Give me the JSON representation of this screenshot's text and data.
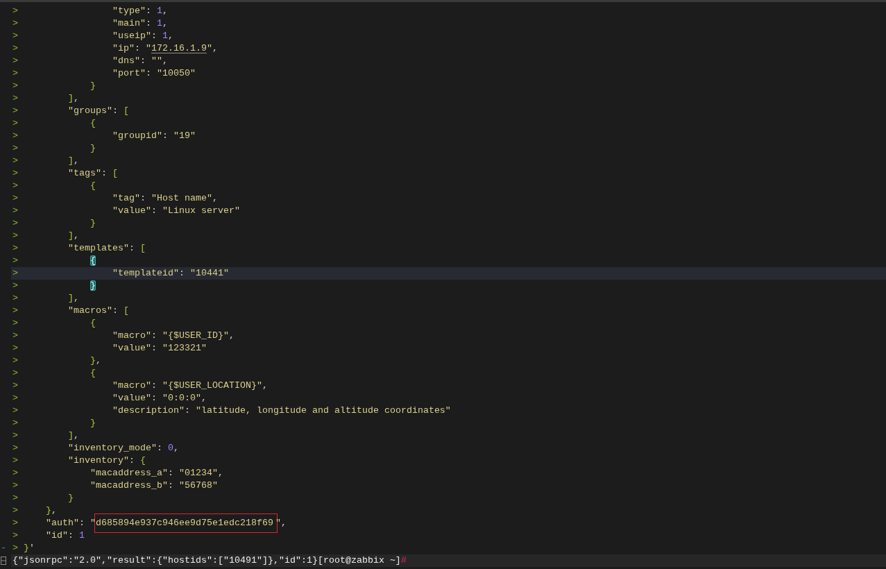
{
  "terminal": {
    "lines": [
      {
        "prompt": ">",
        "current": false,
        "segments": [
          {
            "kind": "string",
            "text": "                 \"type\""
          },
          {
            "kind": "punct",
            "text": ": "
          },
          {
            "kind": "number",
            "text": "1"
          },
          {
            "kind": "punct",
            "text": ","
          }
        ]
      },
      {
        "prompt": ">",
        "current": false,
        "segments": [
          {
            "kind": "string",
            "text": "                 \"main\""
          },
          {
            "kind": "punct",
            "text": ": "
          },
          {
            "kind": "number",
            "text": "1"
          },
          {
            "kind": "punct",
            "text": ","
          }
        ]
      },
      {
        "prompt": ">",
        "current": false,
        "segments": [
          {
            "kind": "string",
            "text": "                 \"useip\""
          },
          {
            "kind": "punct",
            "text": ": "
          },
          {
            "kind": "number",
            "text": "1"
          },
          {
            "kind": "punct",
            "text": ","
          }
        ]
      },
      {
        "prompt": ">",
        "current": false,
        "segments": [
          {
            "kind": "string",
            "text": "                 \"ip\""
          },
          {
            "kind": "punct",
            "text": ": "
          },
          {
            "kind": "string",
            "text": "\""
          },
          {
            "kind": "link",
            "text": "172.16.1.9"
          },
          {
            "kind": "string",
            "text": "\""
          },
          {
            "kind": "punct",
            "text": ","
          }
        ]
      },
      {
        "prompt": ">",
        "current": false,
        "segments": [
          {
            "kind": "string",
            "text": "                 \"dns\""
          },
          {
            "kind": "punct",
            "text": ": "
          },
          {
            "kind": "string",
            "text": "\"\""
          },
          {
            "kind": "punct",
            "text": ","
          }
        ]
      },
      {
        "prompt": ">",
        "current": false,
        "segments": [
          {
            "kind": "string",
            "text": "                 \"port\""
          },
          {
            "kind": "punct",
            "text": ": "
          },
          {
            "kind": "string",
            "text": "\"10050\""
          }
        ]
      },
      {
        "prompt": ">",
        "current": false,
        "segments": [
          {
            "kind": "bracket",
            "text": "             }"
          }
        ]
      },
      {
        "prompt": ">",
        "current": false,
        "segments": [
          {
            "kind": "bracket",
            "text": "         ]"
          },
          {
            "kind": "punct",
            "text": ","
          }
        ]
      },
      {
        "prompt": ">",
        "current": false,
        "segments": [
          {
            "kind": "string",
            "text": "         \"groups\""
          },
          {
            "kind": "punct",
            "text": ": "
          },
          {
            "kind": "bracket",
            "text": "["
          }
        ]
      },
      {
        "prompt": ">",
        "current": false,
        "segments": [
          {
            "kind": "bracket",
            "text": "             {"
          }
        ]
      },
      {
        "prompt": ">",
        "current": false,
        "segments": [
          {
            "kind": "string",
            "text": "                 \"groupid\""
          },
          {
            "kind": "punct",
            "text": ": "
          },
          {
            "kind": "string",
            "text": "\"19\""
          }
        ]
      },
      {
        "prompt": ">",
        "current": false,
        "segments": [
          {
            "kind": "bracket",
            "text": "             }"
          }
        ]
      },
      {
        "prompt": ">",
        "current": false,
        "segments": [
          {
            "kind": "bracket",
            "text": "         ]"
          },
          {
            "kind": "punct",
            "text": ","
          }
        ]
      },
      {
        "prompt": ">",
        "current": false,
        "segments": [
          {
            "kind": "string",
            "text": "         \"tags\""
          },
          {
            "kind": "punct",
            "text": ": "
          },
          {
            "kind": "bracket",
            "text": "["
          }
        ]
      },
      {
        "prompt": ">",
        "current": false,
        "segments": [
          {
            "kind": "bracket",
            "text": "             {"
          }
        ]
      },
      {
        "prompt": ">",
        "current": false,
        "segments": [
          {
            "kind": "string",
            "text": "                 \"tag\""
          },
          {
            "kind": "punct",
            "text": ": "
          },
          {
            "kind": "string",
            "text": "\"Host name\""
          },
          {
            "kind": "punct",
            "text": ","
          }
        ]
      },
      {
        "prompt": ">",
        "current": false,
        "segments": [
          {
            "kind": "string",
            "text": "                 \"value\""
          },
          {
            "kind": "punct",
            "text": ": "
          },
          {
            "kind": "string",
            "text": "\"Linux server\""
          }
        ]
      },
      {
        "prompt": ">",
        "current": false,
        "segments": [
          {
            "kind": "bracket",
            "text": "             }"
          }
        ]
      },
      {
        "prompt": ">",
        "current": false,
        "segments": [
          {
            "kind": "bracket",
            "text": "         ]"
          },
          {
            "kind": "punct",
            "text": ","
          }
        ]
      },
      {
        "prompt": ">",
        "current": false,
        "segments": [
          {
            "kind": "string",
            "text": "         \"templates\""
          },
          {
            "kind": "punct",
            "text": ": "
          },
          {
            "kind": "bracket",
            "text": "["
          }
        ]
      },
      {
        "prompt": ">",
        "current": false,
        "segments": [
          {
            "kind": "matched_bracket",
            "text": "             {"
          }
        ]
      },
      {
        "prompt": ">",
        "current": true,
        "segments": [
          {
            "kind": "string",
            "text": "                 \"templateid\""
          },
          {
            "kind": "punct",
            "text": ": "
          },
          {
            "kind": "string",
            "text": "\"10441\""
          }
        ]
      },
      {
        "prompt": ">",
        "current": false,
        "segments": [
          {
            "kind": "matched_bracket",
            "text": "             }"
          }
        ]
      },
      {
        "prompt": ">",
        "current": false,
        "segments": [
          {
            "kind": "bracket",
            "text": "         ]"
          },
          {
            "kind": "punct",
            "text": ","
          }
        ]
      },
      {
        "prompt": ">",
        "current": false,
        "segments": [
          {
            "kind": "string",
            "text": "         \"macros\""
          },
          {
            "kind": "punct",
            "text": ": "
          },
          {
            "kind": "bracket",
            "text": "["
          }
        ]
      },
      {
        "prompt": ">",
        "current": false,
        "segments": [
          {
            "kind": "bracket",
            "text": "             {"
          }
        ]
      },
      {
        "prompt": ">",
        "current": false,
        "segments": [
          {
            "kind": "string",
            "text": "                 \"macro\""
          },
          {
            "kind": "punct",
            "text": ": "
          },
          {
            "kind": "string",
            "text": "\"{$USER_ID}\""
          },
          {
            "kind": "punct",
            "text": ","
          }
        ]
      },
      {
        "prompt": ">",
        "current": false,
        "segments": [
          {
            "kind": "string",
            "text": "                 \"value\""
          },
          {
            "kind": "punct",
            "text": ": "
          },
          {
            "kind": "string",
            "text": "\"123321\""
          }
        ]
      },
      {
        "prompt": ">",
        "current": false,
        "segments": [
          {
            "kind": "bracket",
            "text": "             }"
          },
          {
            "kind": "punct",
            "text": ","
          }
        ]
      },
      {
        "prompt": ">",
        "current": false,
        "segments": [
          {
            "kind": "bracket",
            "text": "             {"
          }
        ]
      },
      {
        "prompt": ">",
        "current": false,
        "segments": [
          {
            "kind": "string",
            "text": "                 \"macro\""
          },
          {
            "kind": "punct",
            "text": ": "
          },
          {
            "kind": "string",
            "text": "\"{$USER_LOCATION}\""
          },
          {
            "kind": "punct",
            "text": ","
          }
        ]
      },
      {
        "prompt": ">",
        "current": false,
        "segments": [
          {
            "kind": "string",
            "text": "                 \"value\""
          },
          {
            "kind": "punct",
            "text": ": "
          },
          {
            "kind": "string",
            "text": "\"0:0:0\""
          },
          {
            "kind": "punct",
            "text": ","
          }
        ]
      },
      {
        "prompt": ">",
        "current": false,
        "segments": [
          {
            "kind": "string",
            "text": "                 \"description\""
          },
          {
            "kind": "punct",
            "text": ": "
          },
          {
            "kind": "string",
            "text": "\"latitude, longitude and altitude coordinates\""
          }
        ]
      },
      {
        "prompt": ">",
        "current": false,
        "segments": [
          {
            "kind": "bracket",
            "text": "             }"
          }
        ]
      },
      {
        "prompt": ">",
        "current": false,
        "segments": [
          {
            "kind": "bracket",
            "text": "         ]"
          },
          {
            "kind": "punct",
            "text": ","
          }
        ]
      },
      {
        "prompt": ">",
        "current": false,
        "segments": [
          {
            "kind": "string",
            "text": "         \"inventory_mode\""
          },
          {
            "kind": "punct",
            "text": ": "
          },
          {
            "kind": "number",
            "text": "0"
          },
          {
            "kind": "punct",
            "text": ","
          }
        ]
      },
      {
        "prompt": ">",
        "current": false,
        "segments": [
          {
            "kind": "string",
            "text": "         \"inventory\""
          },
          {
            "kind": "punct",
            "text": ": "
          },
          {
            "kind": "bracket",
            "text": "{"
          }
        ]
      },
      {
        "prompt": ">",
        "current": false,
        "segments": [
          {
            "kind": "string",
            "text": "             \"macaddress_a\""
          },
          {
            "kind": "punct",
            "text": ": "
          },
          {
            "kind": "string",
            "text": "\"01234\""
          },
          {
            "kind": "punct",
            "text": ","
          }
        ]
      },
      {
        "prompt": ">",
        "current": false,
        "segments": [
          {
            "kind": "string",
            "text": "             \"macaddress_b\""
          },
          {
            "kind": "punct",
            "text": ": "
          },
          {
            "kind": "string",
            "text": "\"56768\""
          }
        ]
      },
      {
        "prompt": ">",
        "current": false,
        "segments": [
          {
            "kind": "bracket",
            "text": "         }"
          }
        ]
      },
      {
        "prompt": ">",
        "current": false,
        "segments": [
          {
            "kind": "bracket",
            "text": "     }"
          },
          {
            "kind": "punct",
            "text": ","
          }
        ]
      },
      {
        "prompt": ">",
        "current": false,
        "segments": [
          {
            "kind": "string",
            "text": "     \"auth\""
          },
          {
            "kind": "punct",
            "text": ": "
          },
          {
            "kind": "string",
            "text": "\""
          },
          {
            "kind": "boxed",
            "text": "d685894e937c946ee9d75e1edc218f69"
          },
          {
            "kind": "string",
            "text": "\""
          },
          {
            "kind": "punct",
            "text": ","
          }
        ]
      },
      {
        "prompt": ">",
        "current": false,
        "segments": [
          {
            "kind": "string",
            "text": "     \"id\""
          },
          {
            "kind": "punct",
            "text": ": "
          },
          {
            "kind": "number",
            "text": "1"
          }
        ]
      },
      {
        "prompt": ">",
        "current": false,
        "gutter": "-",
        "segments": [
          {
            "kind": "bracket",
            "text": " }"
          },
          {
            "kind": "punct",
            "text": "'"
          }
        ]
      }
    ],
    "output": {
      "text": "{\"jsonrpc\":\"2.0\",\"result\":{\"hostids\":[\"10491\"]},\"id\":1}[root@zabbix ~]",
      "prompt_char": "#"
    }
  }
}
